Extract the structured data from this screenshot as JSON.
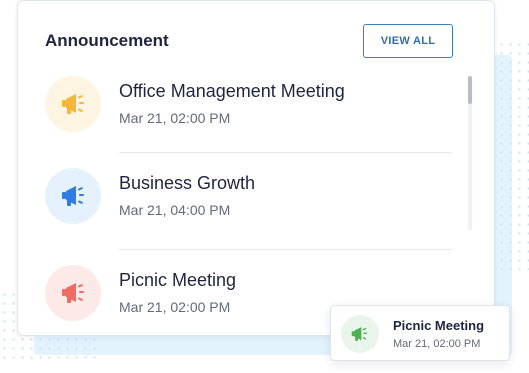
{
  "announcements": {
    "title": "Announcement",
    "view_all_label": "VIEW ALL",
    "items": [
      {
        "name": "Office Management Meeting",
        "time": "Mar 21, 02:00 PM",
        "icon": "megaphone-icon",
        "icon_color": "#f4b73a",
        "icon_bg": "#fdf4e2"
      },
      {
        "name": "Business Growth",
        "time": "Mar 21, 04:00 PM",
        "icon": "megaphone-icon",
        "icon_color": "#2f7de1",
        "icon_bg": "#e5f1fd"
      },
      {
        "name": "Picnic Meeting",
        "time": "Mar 21, 02:00 PM",
        "icon": "megaphone-icon",
        "icon_color": "#ef6b63",
        "icon_bg": "#fde9e7"
      }
    ]
  },
  "notification": {
    "name": "Picnic Meeting",
    "time": "Mar 21, 02:00 PM",
    "icon": "megaphone-icon",
    "icon_color": "#4caf50",
    "icon_bg": "#e9f5ea"
  }
}
